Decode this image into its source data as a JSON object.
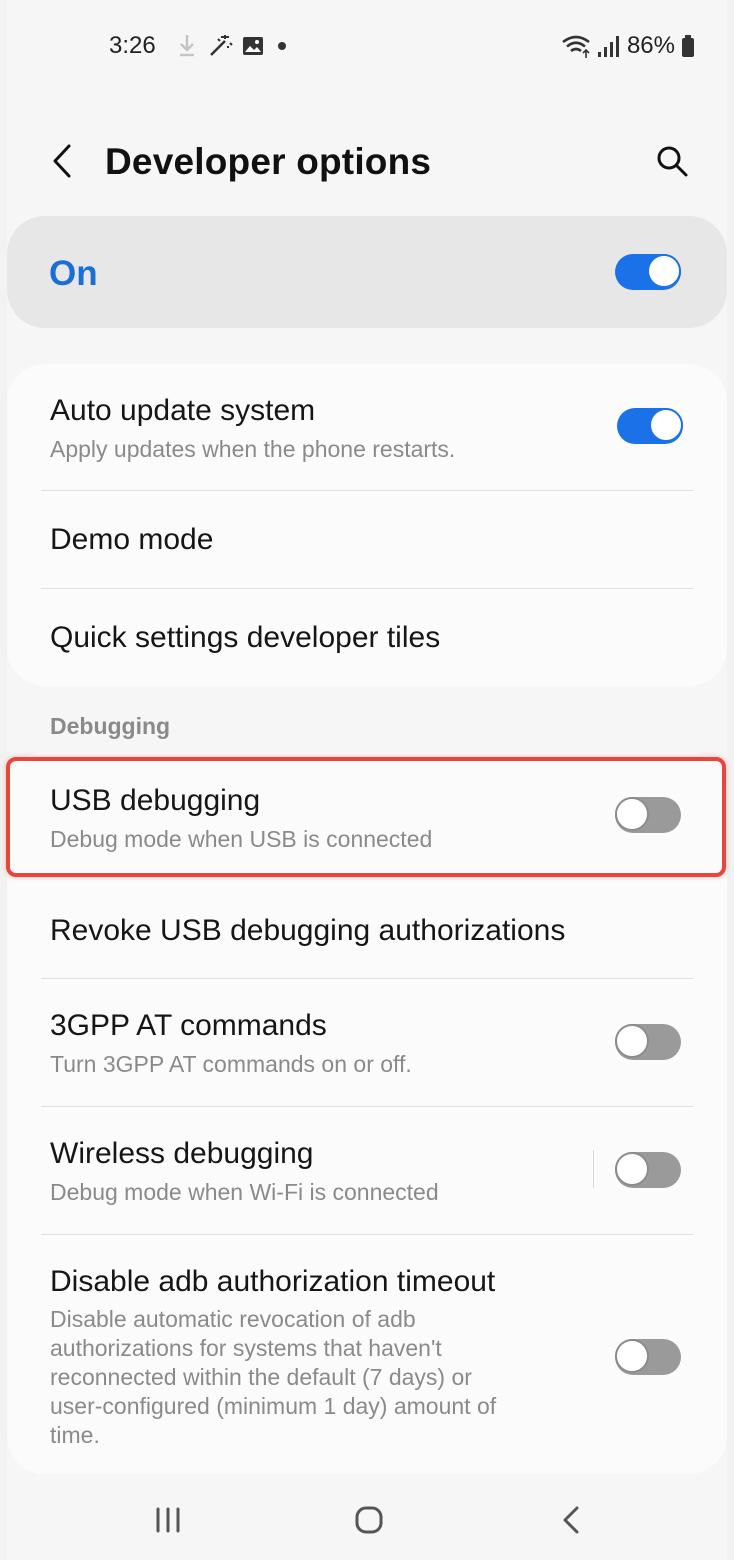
{
  "status_bar": {
    "time": "3:26",
    "battery": "86%",
    "icons_left": [
      "download-icon",
      "magic-wand-icon",
      "image-icon",
      "dot-icon"
    ],
    "icons_right": [
      "wifi-icon",
      "signal-icon",
      "battery-icon"
    ]
  },
  "header": {
    "title": "Developer options",
    "back_icon": "chevron-left-icon",
    "search_icon": "search-icon"
  },
  "master_switch": {
    "label": "On",
    "enabled": true
  },
  "general": {
    "items": [
      {
        "title": "Auto update system",
        "subtitle": "Apply updates when the phone restarts.",
        "toggle": true
      },
      {
        "title": "Demo mode"
      },
      {
        "title": "Quick settings developer tiles"
      }
    ]
  },
  "debugging": {
    "section_label": "Debugging",
    "items": [
      {
        "title": "USB debugging",
        "subtitle": "Debug mode when USB is connected",
        "toggle": false
      },
      {
        "title": "Revoke USB debugging authorizations"
      },
      {
        "title": "3GPP AT commands",
        "subtitle": "Turn 3GPP AT commands on or off.",
        "toggle": false
      },
      {
        "title": "Wireless debugging",
        "subtitle": "Debug mode when Wi-Fi is connected",
        "toggle": false
      },
      {
        "title": "Disable adb authorization timeout",
        "subtitle_lines": [
          "Disable automatic revocation of adb",
          "authorizations for systems that haven't",
          "reconnected within the default (7 days) or",
          "user-configured (minimum 1 day) amount of",
          "time."
        ],
        "toggle": false
      }
    ]
  },
  "nav_bar": {
    "items": [
      "recents-icon",
      "home-icon",
      "back-icon"
    ]
  },
  "colors": {
    "accent": "#1b72e8",
    "highlight": "#e8453c",
    "toggle_off": "#9a9a9a"
  }
}
